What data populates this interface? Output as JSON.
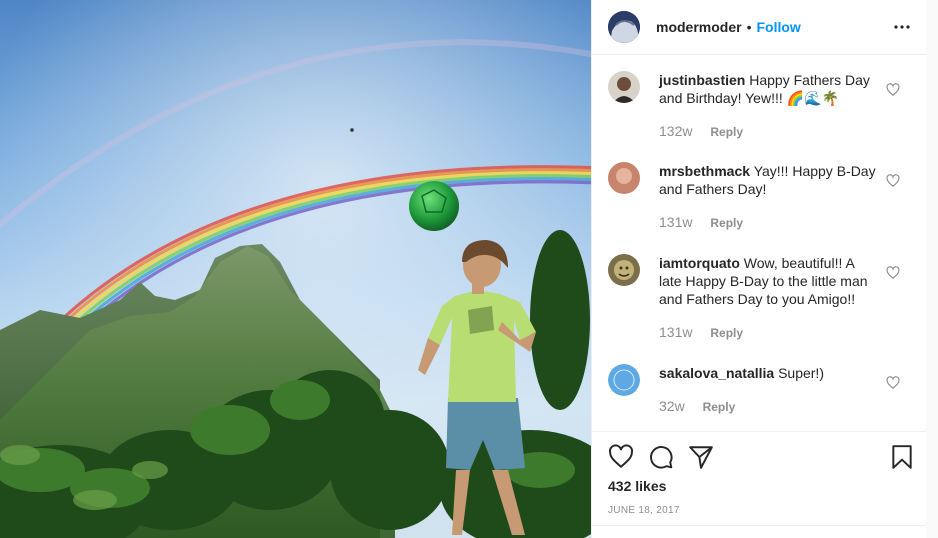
{
  "post": {
    "author": "modermoder",
    "separator": "•",
    "follow_label": "Follow",
    "more_icon": "more-options-icon"
  },
  "comments": [
    {
      "user": "justinbastien",
      "text": "Happy Fathers Day and Birthday! Yew!!! 🌈🌊🌴",
      "time": "132w",
      "reply": "Reply"
    },
    {
      "user": "mrsbethmack",
      "text": "Yay!!! Happy B-Day and Fathers Day!",
      "time": "131w",
      "reply": "Reply"
    },
    {
      "user": "iamtorquato",
      "text": "Wow, beautiful!! A late Happy B-Day to the little man and Fathers Day to you Amigo!!",
      "time": "131w",
      "reply": "Reply"
    },
    {
      "user": "sakalova_natallia",
      "text": "Super!)",
      "time": "32w",
      "reply": "Reply"
    }
  ],
  "actions": {
    "icons": [
      "heart-icon",
      "comment-icon",
      "share-icon",
      "bookmark-icon"
    ],
    "likes": "432 likes",
    "date": "JUNE 18, 2017"
  },
  "colors": {
    "link": "#0095f6",
    "muted": "#8e8e8e",
    "text": "#262626",
    "border": "#efefef"
  }
}
